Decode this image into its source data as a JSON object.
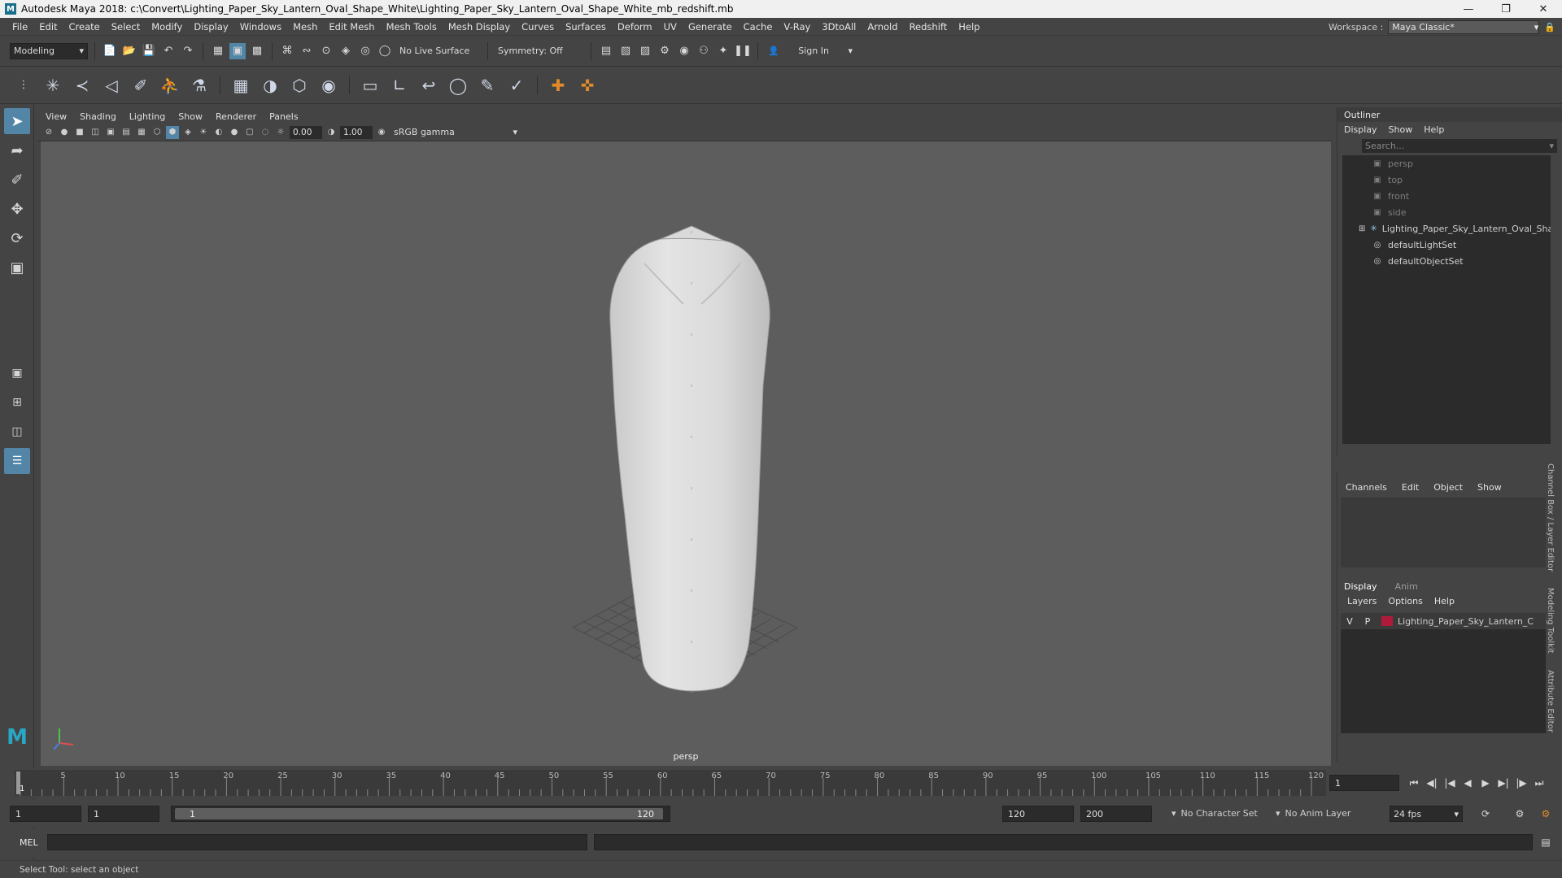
{
  "window": {
    "title": "Autodesk Maya 2018: c:\\Convert\\Lighting_Paper_Sky_Lantern_Oval_Shape_White\\Lighting_Paper_Sky_Lantern_Oval_Shape_White_mb_redshift.mb",
    "logo": "M"
  },
  "menu": [
    "File",
    "Edit",
    "Create",
    "Select",
    "Modify",
    "Display",
    "Windows",
    "Mesh",
    "Edit Mesh",
    "Mesh Tools",
    "Mesh Display",
    "Curves",
    "Surfaces",
    "Deform",
    "UV",
    "Generate",
    "Cache",
    "V-Ray",
    "3DtoAll",
    "Arnold",
    "Redshift",
    "Help"
  ],
  "workspace": {
    "label": "Workspace :",
    "value": "Maya Classic*"
  },
  "statusline": {
    "mode": "Modeling",
    "live_surface": "No Live Surface",
    "symmetry": "Symmetry: Off",
    "sign_in": "Sign In"
  },
  "viewport": {
    "menu": [
      "View",
      "Shading",
      "Lighting",
      "Show",
      "Renderer",
      "Panels"
    ],
    "exposure": "0.00",
    "gamma": "1.00",
    "color_space": "sRGB gamma",
    "camera": "persp"
  },
  "outliner": {
    "title": "Outliner",
    "menu": [
      "Display",
      "Show",
      "Help"
    ],
    "search_placeholder": "Search...",
    "items": [
      {
        "label": "persp",
        "icon": "camera-icon",
        "dim": true
      },
      {
        "label": "top",
        "icon": "camera-icon",
        "dim": true
      },
      {
        "label": "front",
        "icon": "camera-icon",
        "dim": true
      },
      {
        "label": "side",
        "icon": "camera-icon",
        "dim": true
      },
      {
        "label": "Lighting_Paper_Sky_Lantern_Oval_Shape",
        "icon": "transform-icon",
        "dim": false
      },
      {
        "label": "defaultLightSet",
        "icon": "set-icon",
        "dim": false
      },
      {
        "label": "defaultObjectSet",
        "icon": "set-icon",
        "dim": false
      }
    ]
  },
  "channelbox": {
    "menu": [
      "Channels",
      "Edit",
      "Object",
      "Show"
    ]
  },
  "layereditor": {
    "tabs": [
      "Display",
      "Anim"
    ],
    "menu": [
      "Layers",
      "Options",
      "Help"
    ],
    "layer": {
      "v": "V",
      "p": "P",
      "name": "Lighting_Paper_Sky_Lantern_C",
      "color": "#b01a3a"
    }
  },
  "sidetabs": [
    "Channel Box / Layer Editor",
    "Modeling Toolkit",
    "Attribute Editor"
  ],
  "timeline": {
    "ticks": [
      "5",
      "10",
      "15",
      "20",
      "25",
      "30",
      "35",
      "40",
      "45",
      "50",
      "55",
      "60",
      "65",
      "70",
      "75",
      "80",
      "85",
      "90",
      "95",
      "100",
      "105",
      "110",
      "115",
      "120"
    ],
    "start_marker": "1",
    "current_frame": "1"
  },
  "range": {
    "start": "1",
    "playback_start": "1",
    "slider_start": "1",
    "slider_end": "120",
    "playback_end": "120",
    "end": "200",
    "character_set": "No Character Set",
    "anim_layer": "No Anim Layer",
    "fps": "24 fps"
  },
  "cmdline": {
    "label": "MEL"
  },
  "helpline": {
    "text": "Select Tool: select an object"
  },
  "colors": {
    "accent": "#5285a6",
    "layer": "#b01a3a",
    "viewport_bg": "#5d5d5d"
  }
}
